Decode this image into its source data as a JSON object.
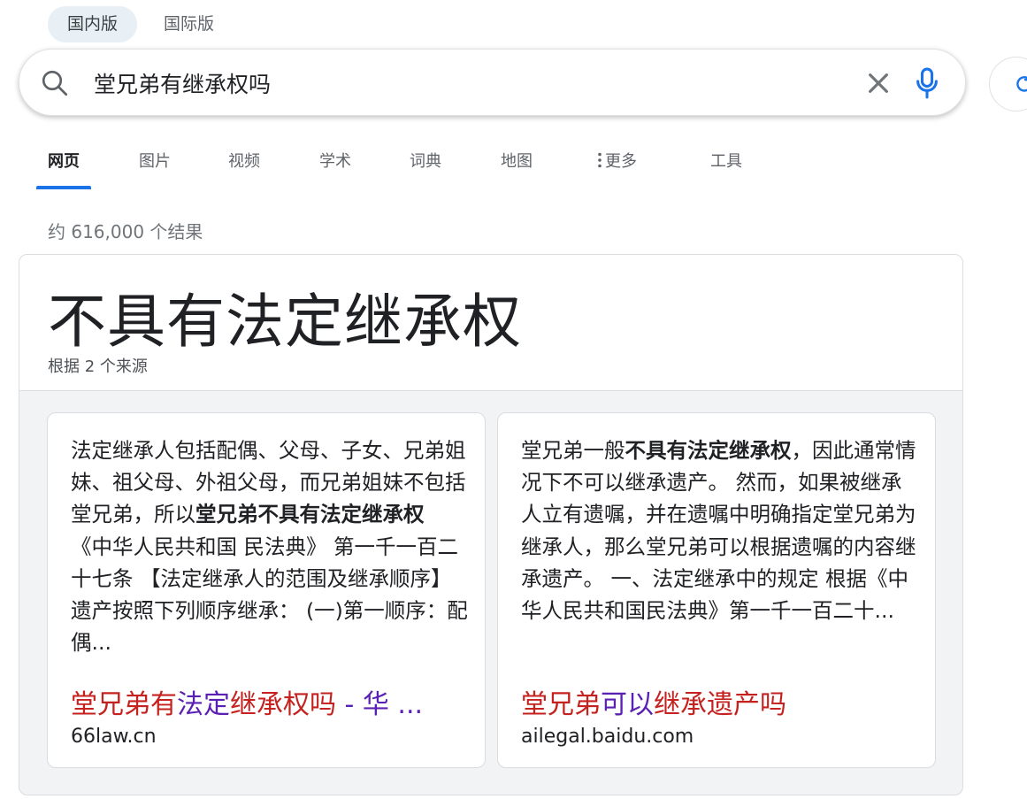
{
  "region_tabs": [
    {
      "label": "国内版",
      "active": true
    },
    {
      "label": "国际版",
      "active": false
    }
  ],
  "search": {
    "query": "堂兄弟有继承权吗"
  },
  "nav": {
    "items": [
      "网页",
      "图片",
      "视频",
      "学术",
      "词典",
      "地图",
      "更多",
      "工具"
    ],
    "active_index": 0
  },
  "results": {
    "count_text": "约 616,000 个结果"
  },
  "answer": {
    "title": "不具有法定继承权",
    "sources_text": "根据 2 个来源",
    "cards": [
      {
        "snippet_parts": [
          {
            "text": "法定继承人包括配偶、父母、子女、兄弟姐妹、祖父母、外祖父母，而兄弟姐妹不包括堂兄弟，所以",
            "bold": false
          },
          {
            "text": "堂兄弟不具有法定继承权",
            "bold": true
          },
          {
            "text": " 《中华人民共和国 民法典》 第一千一百二十七条 【法定继承人的范围及继承顺序】遗产按照下列顺序继承： (一)第一顺序：配偶...",
            "bold": false
          }
        ],
        "title_parts": [
          {
            "text": "堂兄弟有",
            "style": "hl"
          },
          {
            "text": "法定",
            "style": "v"
          },
          {
            "text": "继承权吗",
            "style": "hl"
          },
          {
            "text": " - 华 ...",
            "style": "v"
          }
        ],
        "domain": "66law.cn"
      },
      {
        "snippet_parts": [
          {
            "text": "堂兄弟一般",
            "bold": false
          },
          {
            "text": "不具有法定继承权",
            "bold": true
          },
          {
            "text": "，因此通常情况下不可以继承遗产。 然而，如果被继承人立有遗嘱，并在遗嘱中明确指定堂兄弟为继承人，那么堂兄弟可以根据遗嘱的内容继承遗产。 一、法定继承中的规定 根据《中华人民共和国民法典》第一千一百二十...",
            "bold": false
          }
        ],
        "title_parts": [
          {
            "text": "堂兄弟",
            "style": "hl"
          },
          {
            "text": "可以",
            "style": "v"
          },
          {
            "text": "继承遗产",
            "style": "hl"
          },
          {
            "text": "吗",
            "style": "hl"
          }
        ],
        "domain": "ailegal.baidu.com"
      }
    ]
  },
  "colors": {
    "accent": "#1a73e8",
    "title_red": "#c5221f",
    "title_purple": "#5a20b3",
    "card_bg": "#f1f3f4"
  },
  "icons": [
    "search-icon",
    "clear-icon",
    "mic-icon",
    "more-vert-icon",
    "refresh-icon"
  ]
}
